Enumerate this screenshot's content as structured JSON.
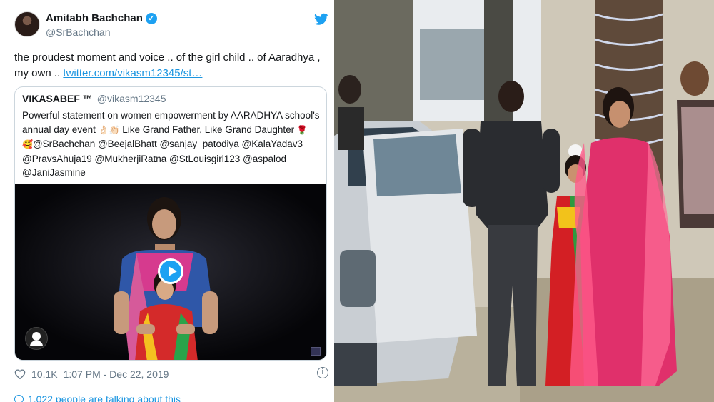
{
  "tweet": {
    "author_name": "Amitabh Bachchan",
    "author_handle": "@SrBachchan",
    "verified": true,
    "text": "the proudest moment and voice .. of the girl child .. of Aaradhya , my own .. ",
    "link_text": "twitter.com/vikasm12345/st…",
    "likes": "10.1K",
    "timestamp": "1:07 PM - Dec 22, 2019",
    "talking": "1,022 people are talking about this",
    "icons": [
      "twitter-bird-icon",
      "verified-badge-icon",
      "heart-icon",
      "info-icon",
      "comment-bubble-icon",
      "play-icon",
      "user-avatar-icon"
    ]
  },
  "quoted": {
    "name": "VIKASABEF ™",
    "handle": "@vikasm12345",
    "text_1": "Powerful statement on women empowerment by AARADHYA school's annual day event ",
    "emoji_1": "👌🏻👏🏻",
    "text_2": " Like Grand Father, Like Grand Daughter ",
    "emoji_2": "🌹",
    "emoji_3": "🥰",
    "text_3": "@SrBachchan @BeejalBhatt @sanjay_patodiya @KalaYadav3 @PravsAhuja19 @MukherjiRatna @StLouisgirl123 @aspalod @JaniJasmine"
  },
  "colors": {
    "twitter_blue": "#1da1f2",
    "link": "#1b95e0",
    "muted": "#657786"
  }
}
